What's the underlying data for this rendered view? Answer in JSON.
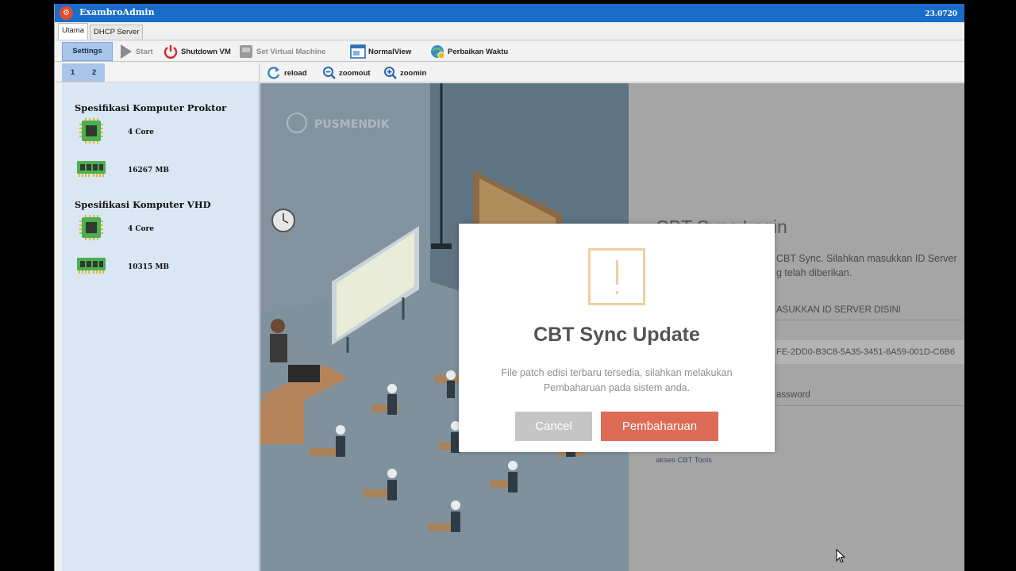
{
  "window": {
    "title": "ExambroAdmin",
    "version": "23.0720"
  },
  "tabs": [
    {
      "label": "Utama"
    },
    {
      "label": "DHCP Server"
    }
  ],
  "toolbar": {
    "settings": "Settings",
    "start": "Start",
    "shutdown": "Shutdown VM",
    "set_vm": "Set Virtual Machine",
    "normal_view": "NormalView",
    "perbaikan_waktu": "Perbaikan Waktu"
  },
  "subtoolbar": {
    "pages": [
      "1",
      "2"
    ],
    "reload": "reload",
    "zoomout": "zoomout",
    "zoomin": "zoomin"
  },
  "sidebar": {
    "proktor": {
      "title": "Spesifikasi Komputer Proktor",
      "cpu": "4 Core",
      "ram": "16267 MB"
    },
    "vhd": {
      "title": "Spesifikasi Komputer VHD",
      "cpu": "4 Core",
      "ram": "10315 MB"
    }
  },
  "webview": {
    "brand": "PUSMENDIK",
    "login_title": "CBT Sync Login",
    "login_desc_1": "CBT Sync. Silahkan masukkan ID Server",
    "login_desc_2": "g telah diberikan.",
    "server_id_placeholder": "ASUKKAN ID SERVER DISINI",
    "server_id_value": "FE-2DD0-B3C8-5A35-3451-6A59-001D-C6B6",
    "password_placeholder": "assword",
    "tools_link": "akses CBT Tools"
  },
  "dialog": {
    "title": "CBT Sync Update",
    "message_1": "File patch edisi terbaru tersedia, silahkan melakukan",
    "message_2": "Pembaharuan pada sistem anda.",
    "cancel": "Cancel",
    "confirm": "Pembaharuan"
  },
  "colors": {
    "titlebar": "#1a6cc9",
    "sidebar": "#d9e6f3",
    "confirm_button": "#dd6b55",
    "cancel_button": "#c5c5c5",
    "warning_icon": "#f0cfa0"
  }
}
